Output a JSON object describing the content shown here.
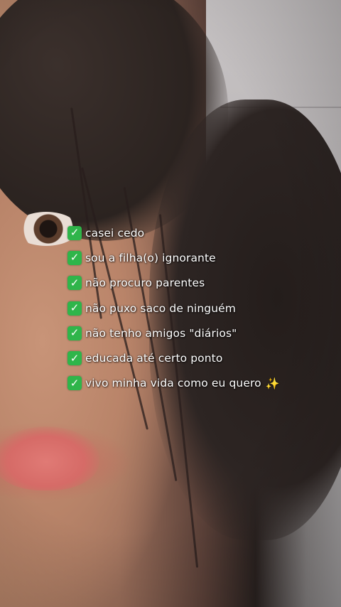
{
  "overlay": {
    "items": [
      {
        "check": "✓",
        "text": "casei cedo"
      },
      {
        "check": "✓",
        "text": "sou a filha(o) ignorante"
      },
      {
        "check": "✓",
        "text": "não procuro parentes"
      },
      {
        "check": "✓",
        "text": "não puxo saco de ninguém"
      },
      {
        "check": "✓",
        "text": "não tenho amigos \"diários\""
      },
      {
        "check": "✓",
        "text": "educada até certo ponto"
      },
      {
        "check": "✓",
        "text": "vivo minha vida como eu quero",
        "emoji": "✨"
      }
    ]
  },
  "icons": {
    "check_icon": "check-mark-button-icon",
    "sparkles_icon": "sparkles-icon"
  },
  "colors": {
    "check_green": "#2fb54a",
    "text": "#ffffff",
    "sparkles": "#ffd93b"
  }
}
